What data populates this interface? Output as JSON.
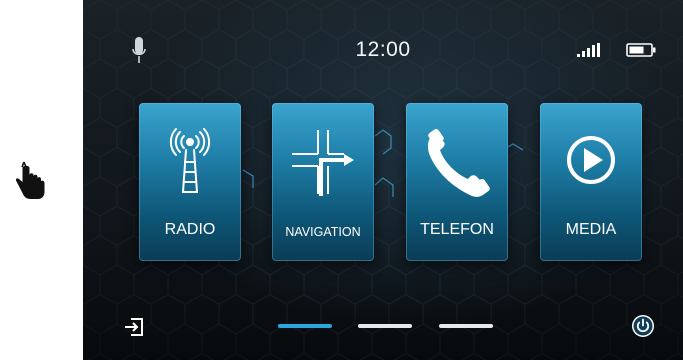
{
  "status_bar": {
    "time": "12:00",
    "icons": [
      "microphone-icon",
      "signal-strength-icon",
      "battery-icon"
    ]
  },
  "tiles": [
    {
      "label": "RADIO",
      "icon": "radio-antenna-icon"
    },
    {
      "label": "NAVIGATION",
      "icon": "navigation-arrow-icon"
    },
    {
      "label": "TELEFON",
      "icon": "phone-icon"
    },
    {
      "label": "MEDIA",
      "icon": "play-icon"
    }
  ],
  "bottom_bar": {
    "exit_icon": "exit-icon",
    "power_icon": "power-icon",
    "page_indicator": {
      "pages": 3,
      "active": 1
    }
  },
  "pointer": {
    "icon": "hand-pointer-icon"
  },
  "colors": {
    "accent": "#2aa7dc",
    "tile_top": "#3aa4cf",
    "tile_bottom": "#0b3c55",
    "background": "#10161b",
    "text": "#ffffff"
  }
}
